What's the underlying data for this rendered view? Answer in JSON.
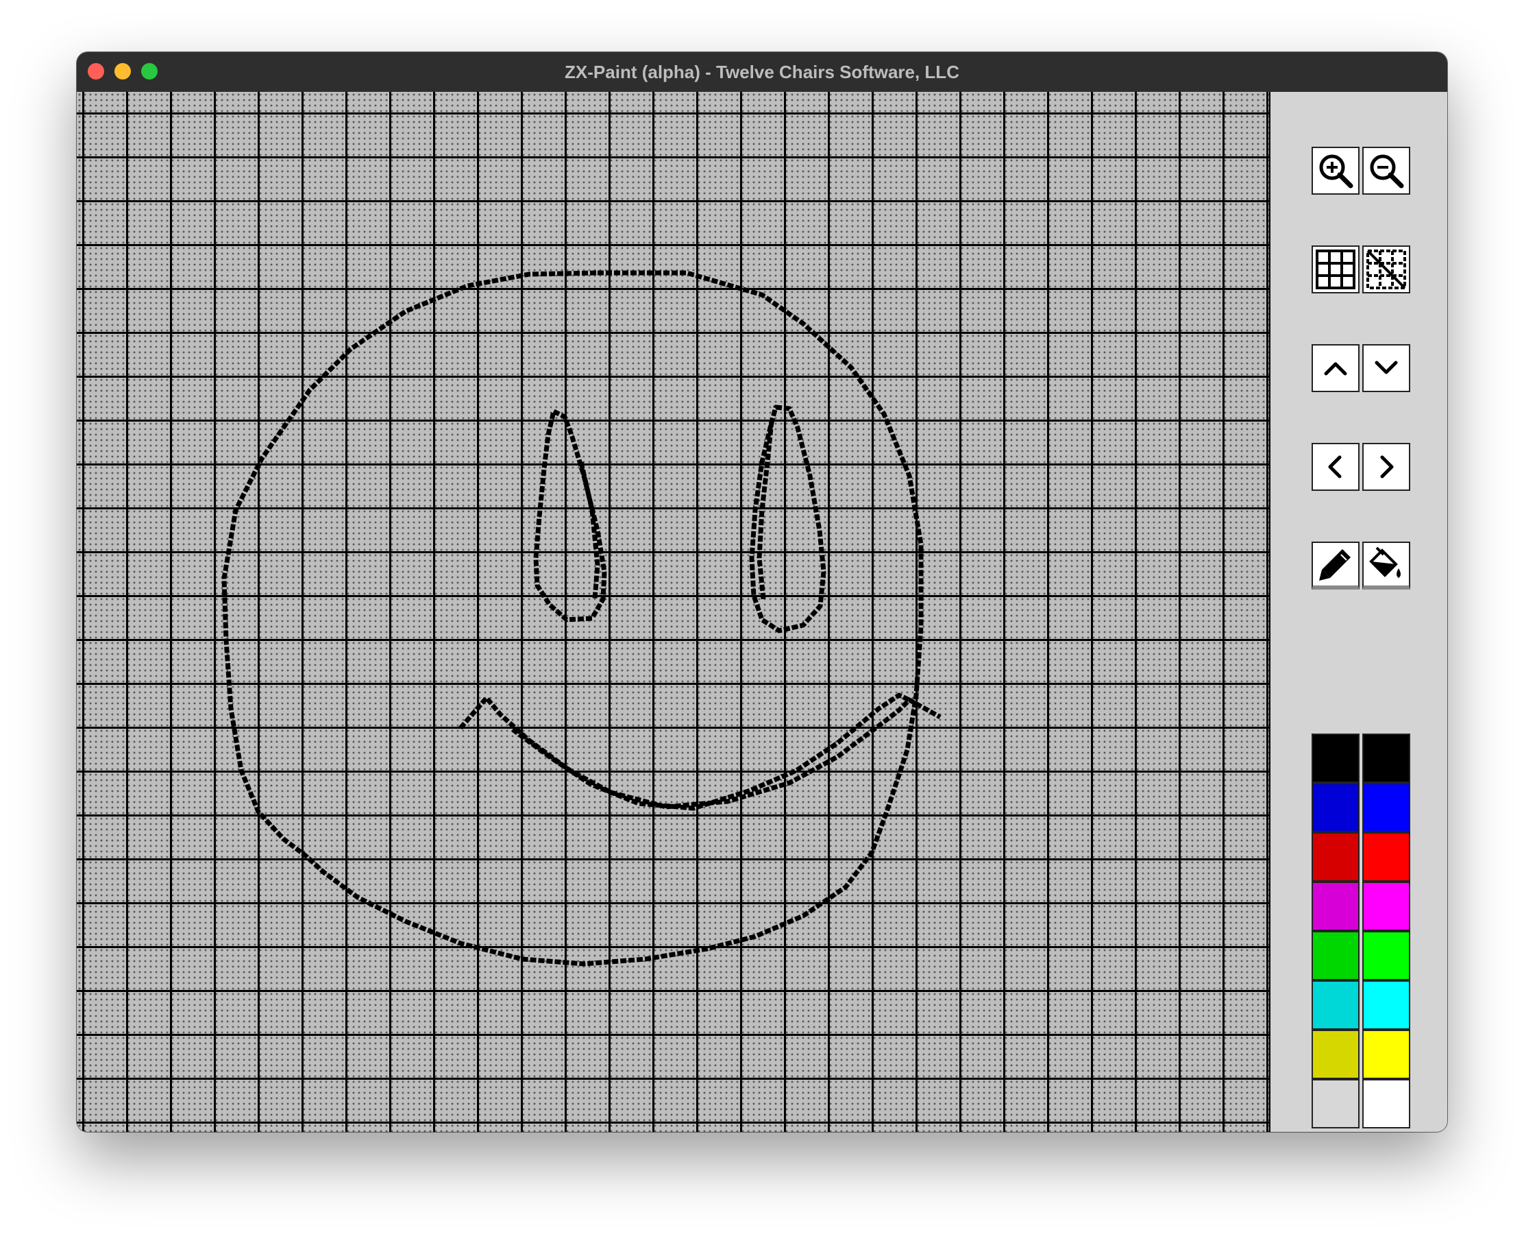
{
  "window": {
    "title": "ZX-Paint (alpha) - Twelve Chairs Software, LLC"
  },
  "canvas": {
    "grid_visible": true,
    "drawing": "smiley face"
  },
  "toolbar": {
    "zoom_in": "zoom-in-icon",
    "zoom_out": "zoom-out-icon",
    "grid_on": "grid-icon",
    "grid_off": "grid-off-icon",
    "scroll_up": "chevron-up-icon",
    "scroll_down": "chevron-down-icon",
    "scroll_left": "chevron-left-icon",
    "scroll_right": "chevron-right-icon",
    "pencil": "pencil-icon",
    "fill": "paint-bucket-icon"
  },
  "palette": {
    "normal": [
      "#000000",
      "#0000d7",
      "#d70000",
      "#d700d7",
      "#00d700",
      "#00d7d7",
      "#d7d700",
      "#d7d7d7"
    ],
    "bright": [
      "#000000",
      "#0000ff",
      "#ff0000",
      "#ff00ff",
      "#00ff00",
      "#00ffff",
      "#ffff00",
      "#ffffff"
    ]
  }
}
